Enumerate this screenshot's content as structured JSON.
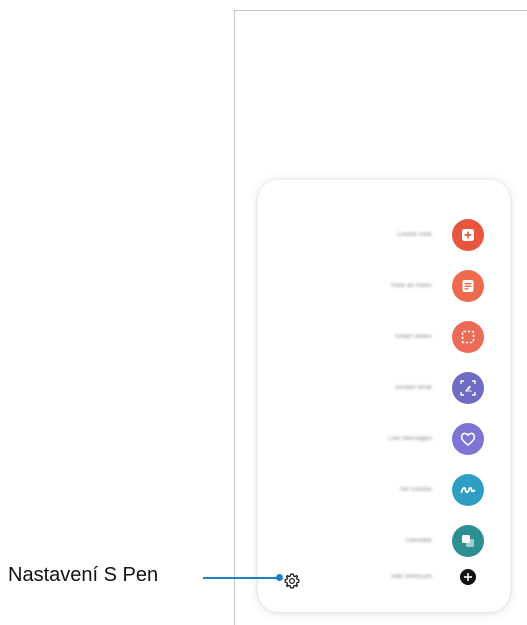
{
  "callout": {
    "label": "Nastavení S Pen",
    "color": "#1f7fc4"
  },
  "air_command_menu": {
    "items": [
      {
        "label": "Create note",
        "icon": "create-note-icon",
        "color": "#e8553f"
      },
      {
        "label": "View all notes",
        "icon": "view-notes-icon",
        "color": "#ee6a4c"
      },
      {
        "label": "Smart select",
        "icon": "smart-select-icon",
        "color": "#ec6a58"
      },
      {
        "label": "Screen write",
        "icon": "screen-write-icon",
        "color": "#6f6cc4"
      },
      {
        "label": "Live messages",
        "icon": "live-messages-icon",
        "color": "#7d74d6"
      },
      {
        "label": "AR Doodle",
        "icon": "ar-doodle-icon",
        "color": "#2f9ec4"
      },
      {
        "label": "Translate",
        "icon": "translate-icon",
        "color": "#2c8f92"
      },
      {
        "label": "Add shortcuts",
        "icon": "add-icon",
        "color": "#111111"
      }
    ],
    "settings_icon": "gear-icon"
  }
}
